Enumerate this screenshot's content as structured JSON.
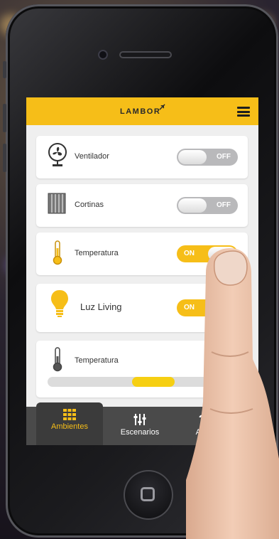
{
  "app": {
    "logo_text": "LAMBOR"
  },
  "devices": [
    {
      "label": "Ventilador",
      "state": "OFF",
      "icon": "fan-icon"
    },
    {
      "label": "Cortinas",
      "state": "OFF",
      "icon": "blinds-icon"
    },
    {
      "label": "Temperatura",
      "state": "ON",
      "icon": "thermometer-icon"
    },
    {
      "label": "Luz Living",
      "state": "ON",
      "icon": "lightbulb-icon"
    },
    {
      "label": "Temperatura",
      "icon": "thermometer-icon",
      "slider_level": 0.58
    }
  ],
  "nav": {
    "tabs": [
      {
        "label": "Ambientes",
        "icon": "grid-icon",
        "active": true
      },
      {
        "label": "Escenarios",
        "icon": "sliders-icon",
        "active": false
      },
      {
        "label": "Ayu",
        "icon": "help-icon",
        "active": false
      }
    ]
  },
  "colors": {
    "accent": "#f6be18",
    "nav_bg": "#4a4a4a",
    "toggle_off": "#b9b9bb"
  }
}
